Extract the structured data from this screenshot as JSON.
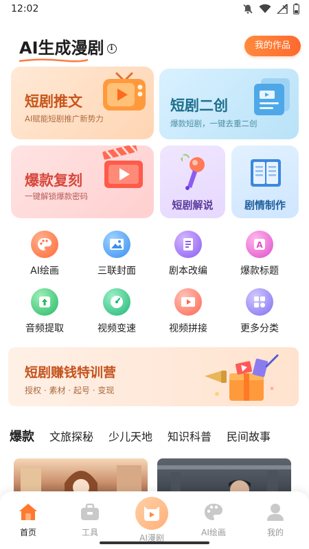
{
  "status_bar": {
    "time": "12:02"
  },
  "header": {
    "brand_title": "AI生成漫剧",
    "info_icon": "i",
    "my_works_label": "我的作品"
  },
  "feature_cards": {
    "tuiwen": {
      "title": "短剧推文",
      "subtitle": "AI赋能短剧推广新势力"
    },
    "erchuang": {
      "title": "短剧二创",
      "subtitle": "爆款短剧，一键去重二创"
    },
    "fuke": {
      "title": "爆款复刻",
      "subtitle": "一键解锁爆款密码"
    },
    "jieshuo": {
      "title": "短剧解说"
    },
    "zhizuo": {
      "title": "剧情制作"
    }
  },
  "tools": [
    {
      "label": "AI绘画",
      "icon": "palette-icon",
      "color": "#ff7a4a"
    },
    {
      "label": "三联封面",
      "icon": "image-icon",
      "color": "#3fa0f0"
    },
    {
      "label": "剧本改编",
      "icon": "script-icon",
      "color": "#9b6bf0"
    },
    {
      "label": "爆款标题",
      "icon": "title-icon",
      "color": "#e86ad0"
    },
    {
      "label": "音频提取",
      "icon": "audio-icon",
      "color": "#3cc07a"
    },
    {
      "label": "视频变速",
      "icon": "speed-icon",
      "color": "#2fb97b"
    },
    {
      "label": "视频拼接",
      "icon": "splice-icon",
      "color": "#ff6f5e"
    },
    {
      "label": "更多分类",
      "icon": "grid-icon",
      "color": "#8c7cf0"
    }
  ],
  "banner": {
    "title": "短剧赚钱特训营",
    "subtitle": "授权 · 素材 · 起号 · 变现"
  },
  "categories": [
    "爆款",
    "文旅探秘",
    "少儿天地",
    "知识科普",
    "民间故事"
  ],
  "tabbar": [
    {
      "label": "首页",
      "icon": "home-icon"
    },
    {
      "label": "工具",
      "icon": "toolbox-icon"
    },
    {
      "label": "AI漫剧",
      "icon": "ai-comic-icon"
    },
    {
      "label": "AI绘画",
      "icon": "palette-icon"
    },
    {
      "label": "我的",
      "icon": "profile-icon"
    }
  ],
  "colors": {
    "accent": "#ff6a2e"
  }
}
